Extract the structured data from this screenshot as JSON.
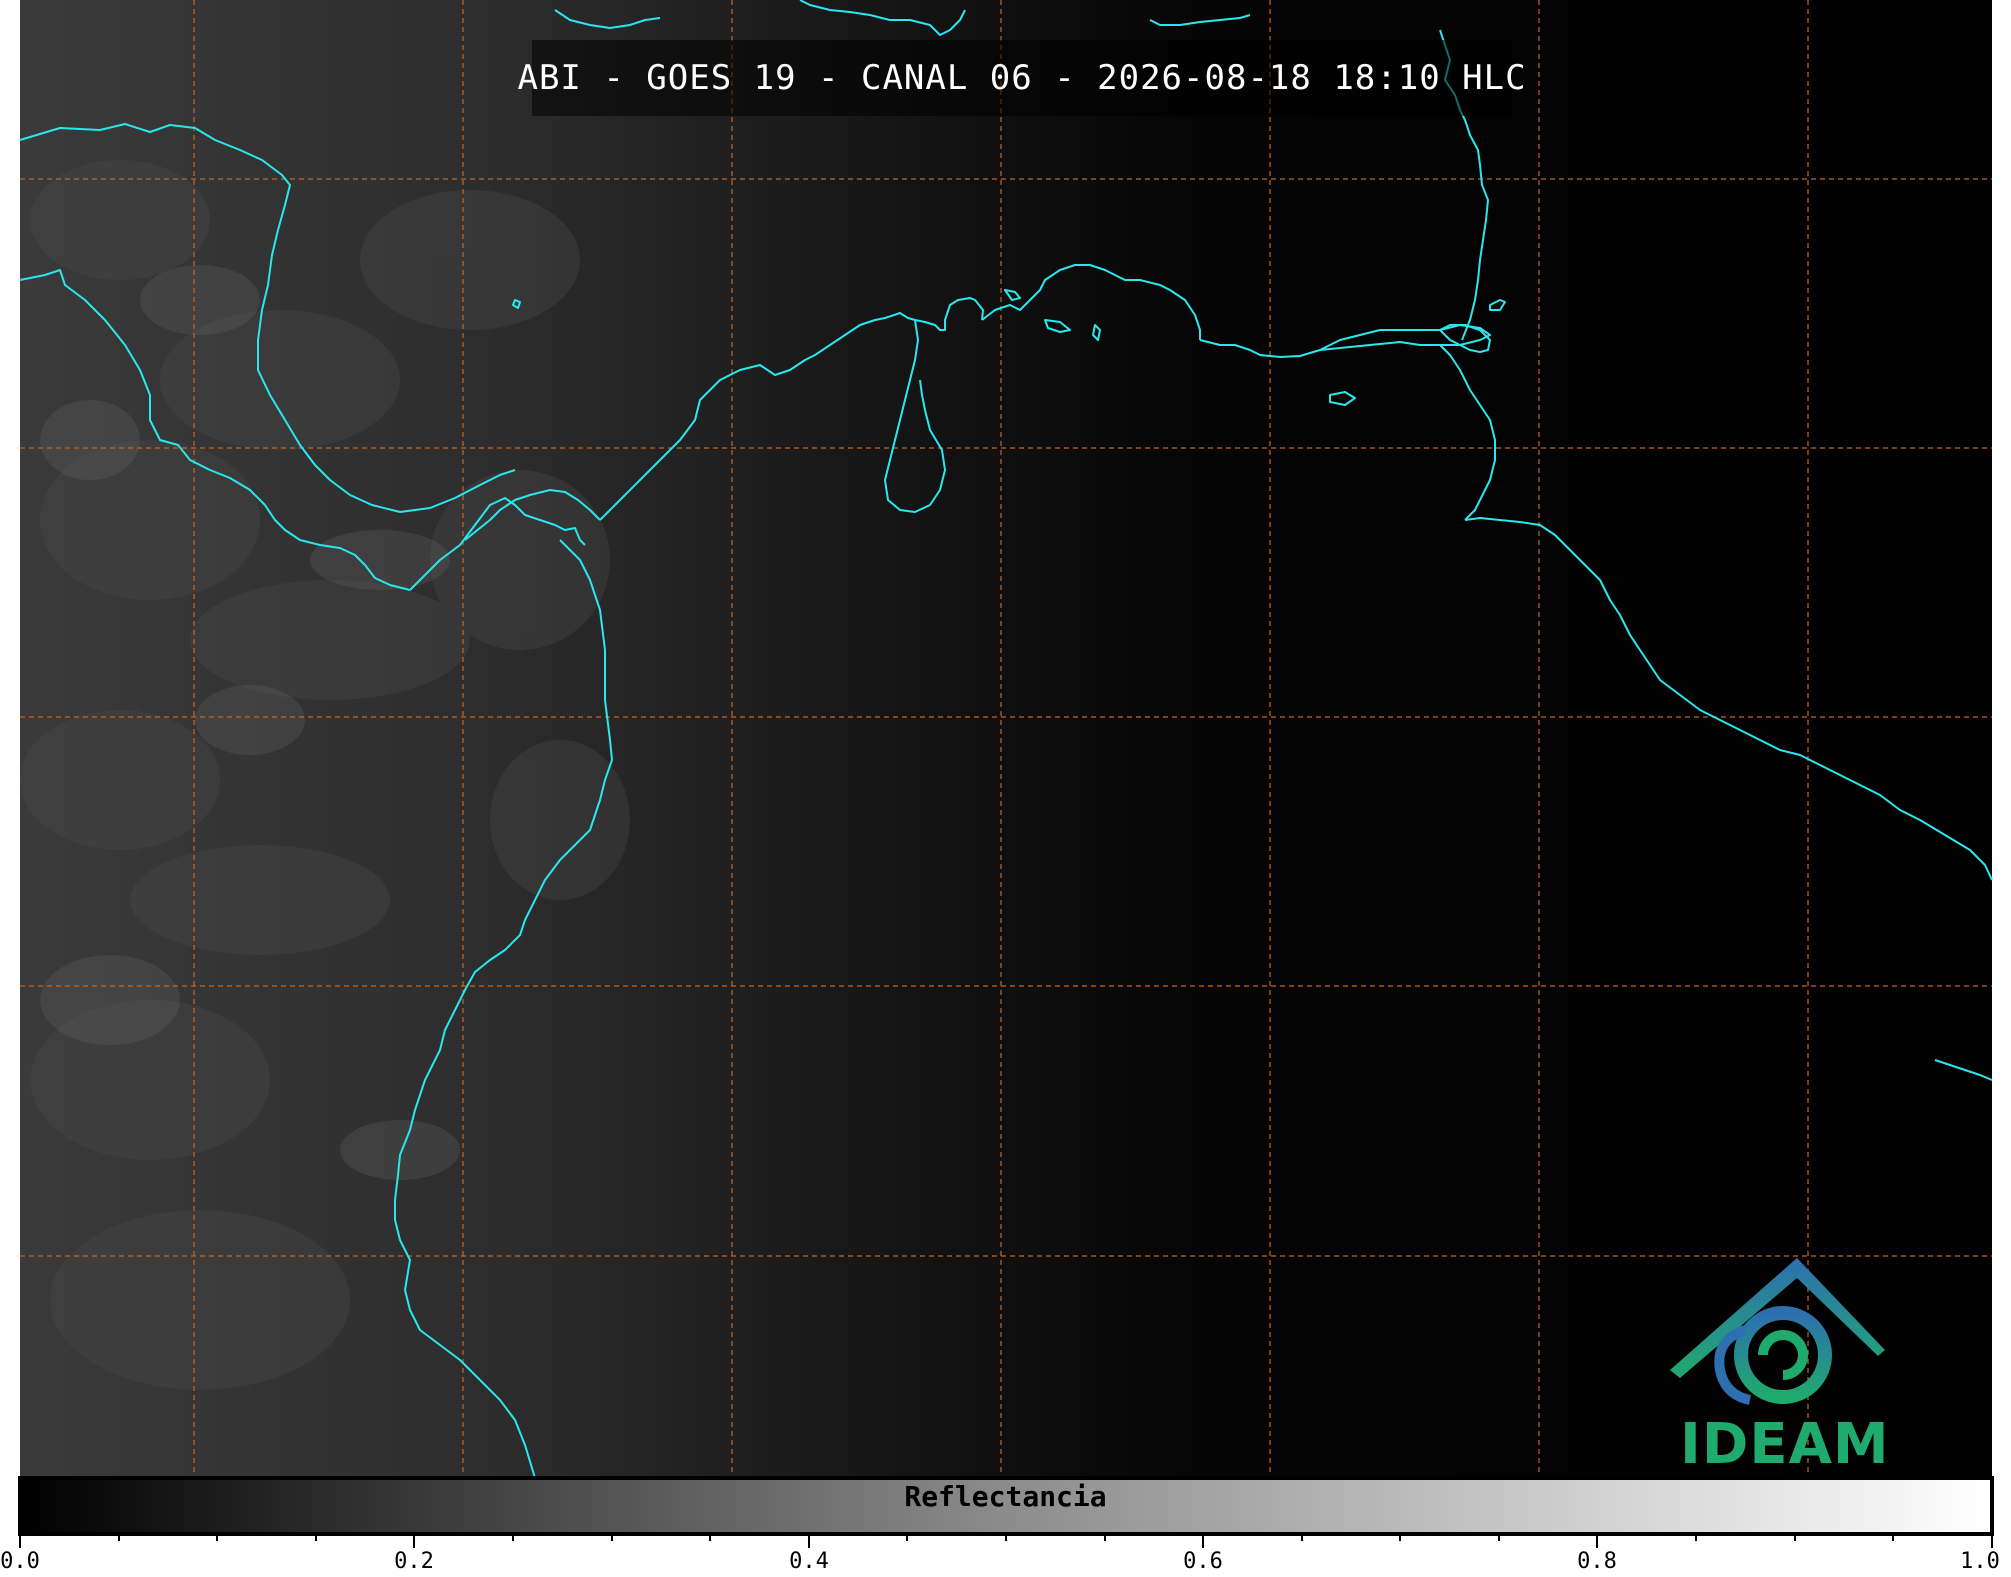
{
  "title": "ABI - GOES 19 - CANAL 06 - 2026-08-18 18:10 HLC",
  "colorbar": {
    "label": "Reflectancia",
    "min": 0.0,
    "max": 1.0,
    "tick_labels": [
      "0.0",
      "0.2",
      "0.4",
      "0.6",
      "0.8",
      "1.0"
    ],
    "colormap": "greys"
  },
  "logo": {
    "text": "IDEAM"
  },
  "colors": {
    "coastline": "#28e8ee",
    "gridline": "#c8661e",
    "background": "#000000",
    "logo_blue": "#2e6fb0",
    "logo_green": "#1faa6e"
  }
}
